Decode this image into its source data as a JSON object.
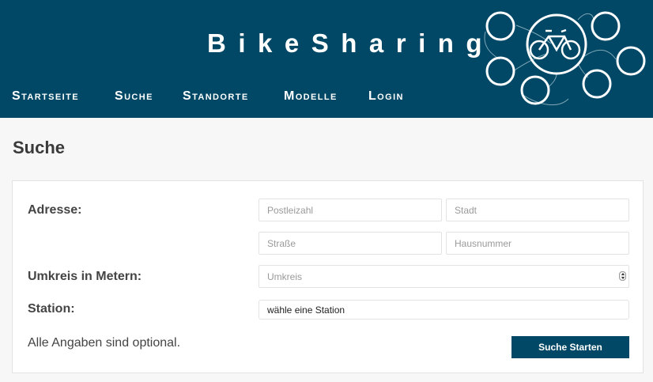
{
  "header": {
    "brand": "BikeSharing",
    "nav": [
      {
        "label": "Startseite"
      },
      {
        "label": "Suche"
      },
      {
        "label": "Standorte"
      },
      {
        "label": "Modelle"
      },
      {
        "label": "Login"
      }
    ],
    "logo_icon": "bicycle-network-icon"
  },
  "page": {
    "title": "Suche"
  },
  "form": {
    "address_label": "Adresse:",
    "postcode_placeholder": "Postleizahl",
    "city_placeholder": "Stadt",
    "street_placeholder": "Straße",
    "housenumber_placeholder": "Hausnummer",
    "radius_label": "Umkreis in Metern:",
    "radius_placeholder": "Umkreis",
    "station_label": "Station:",
    "station_value": "wähle eine Station",
    "note": "Alle Angaben sind optional.",
    "submit_label": "Suche Starten"
  },
  "colors": {
    "header_bg": "#004866",
    "button_bg": "#004866",
    "page_bg": "#f7f7f7"
  }
}
